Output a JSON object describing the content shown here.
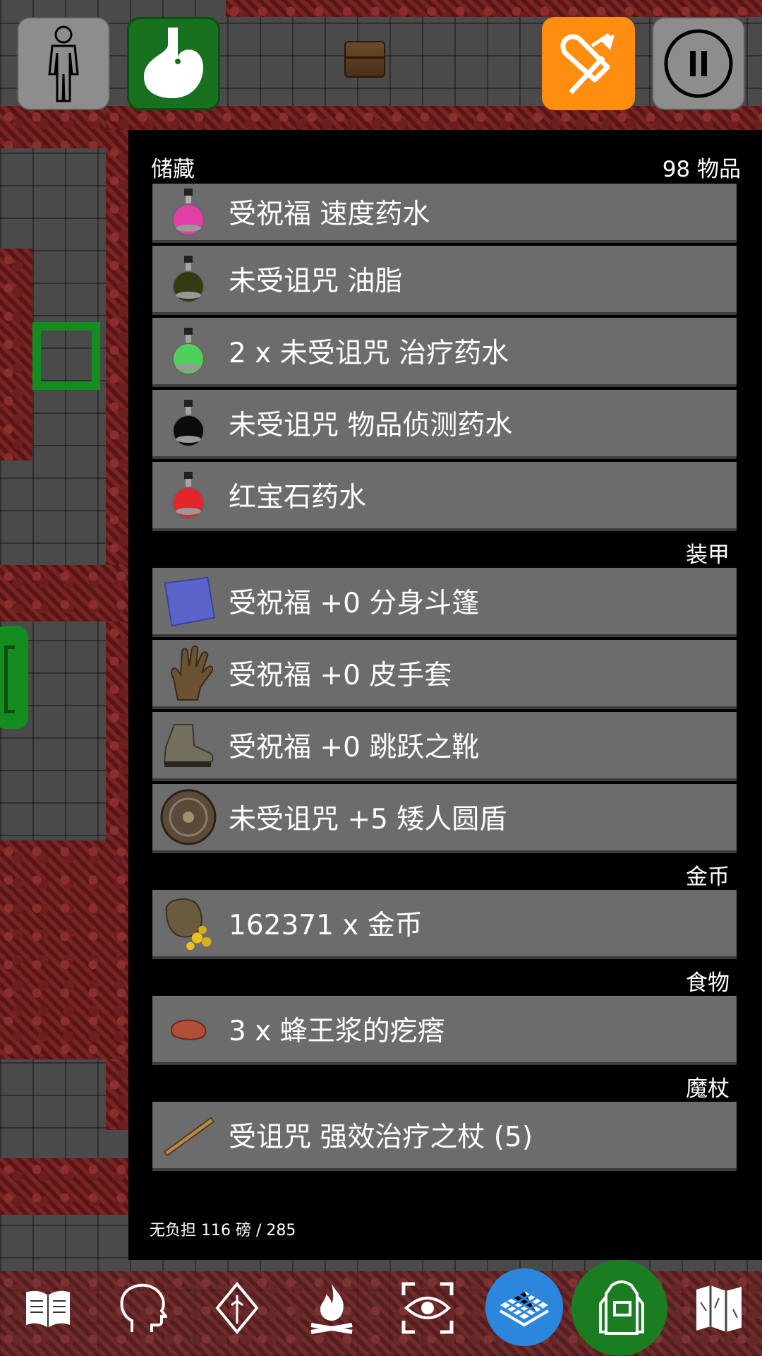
{
  "header": {
    "title": "储藏",
    "count": "98 物品"
  },
  "items": [
    {
      "label": "受祝福 速度药水",
      "icon": "pink-potion-icon"
    },
    {
      "label": "未受诅咒 油脂",
      "icon": "olive-potion-icon"
    },
    {
      "label": "2 x 未受诅咒 治疗药水",
      "icon": "green-potion-icon"
    },
    {
      "label": "未受诅咒 物品侦测药水",
      "icon": "black-potion-icon"
    },
    {
      "label": "红宝石药水",
      "icon": "red-potion-icon"
    },
    {
      "label": "受祝福 +0 分身斗篷",
      "icon": "cloak-icon"
    },
    {
      "label": "受祝福 +0 皮手套",
      "icon": "glove-icon"
    },
    {
      "label": "受祝福 +0 跳跃之靴",
      "icon": "boot-icon"
    },
    {
      "label": "未受诅咒 +5 矮人圆盾",
      "icon": "round-shield-icon"
    },
    {
      "label": "162371 x 金币",
      "icon": "gold-bag-icon"
    },
    {
      "label": "3 x 蜂王浆的疙瘩",
      "icon": "royal-jelly-icon"
    },
    {
      "label": "受诅咒 强效治疗之杖 (5)",
      "icon": "wand-icon"
    }
  ],
  "categories": {
    "armor": "装甲",
    "gold": "金币",
    "food": "食物",
    "wands": "魔杖"
  },
  "footer": {
    "weight": "无负担 116 磅 / 285"
  },
  "colors": {
    "accent_orange": "#ff8d10",
    "accent_green": "#17711f",
    "accent_blue": "#2b86de",
    "item_bg": "#6c6c6c",
    "panel_bg": "#000000"
  },
  "toolbar_icons": [
    "book-icon",
    "head-icon",
    "magic-gem-icon",
    "campfire-icon",
    "eye-icon",
    "tiles-icon",
    "backpack-icon",
    "map-icon"
  ]
}
